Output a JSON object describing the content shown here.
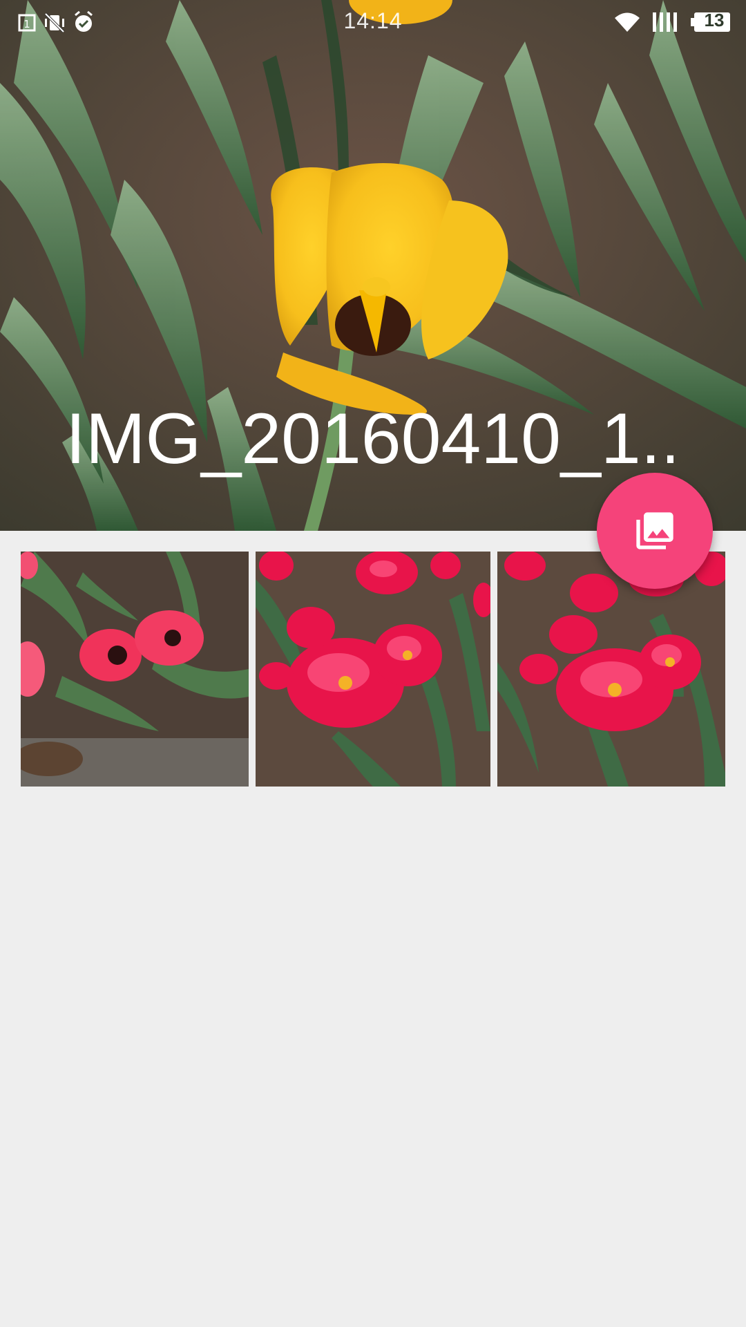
{
  "status_bar": {
    "time": "14:14",
    "battery_level": "13",
    "icons": [
      "sim-1-icon",
      "vibrate-icon",
      "alarm-icon",
      "wifi-icon",
      "signal-icon",
      "battery-icon"
    ]
  },
  "header": {
    "photo_title": "IMG_20160410_1...",
    "image": "yellow-tulip-photo"
  },
  "fab": {
    "icon": "photo-library-icon",
    "color": "#f5437a"
  },
  "gallery": {
    "thumbnails": [
      {
        "image": "pink-tulips-photo"
      },
      {
        "image": "red-peony-tulips-photo"
      },
      {
        "image": "red-peony-tulips-photo-2"
      }
    ]
  },
  "colors": {
    "background": "#eeeeee",
    "accent": "#f5437a"
  }
}
